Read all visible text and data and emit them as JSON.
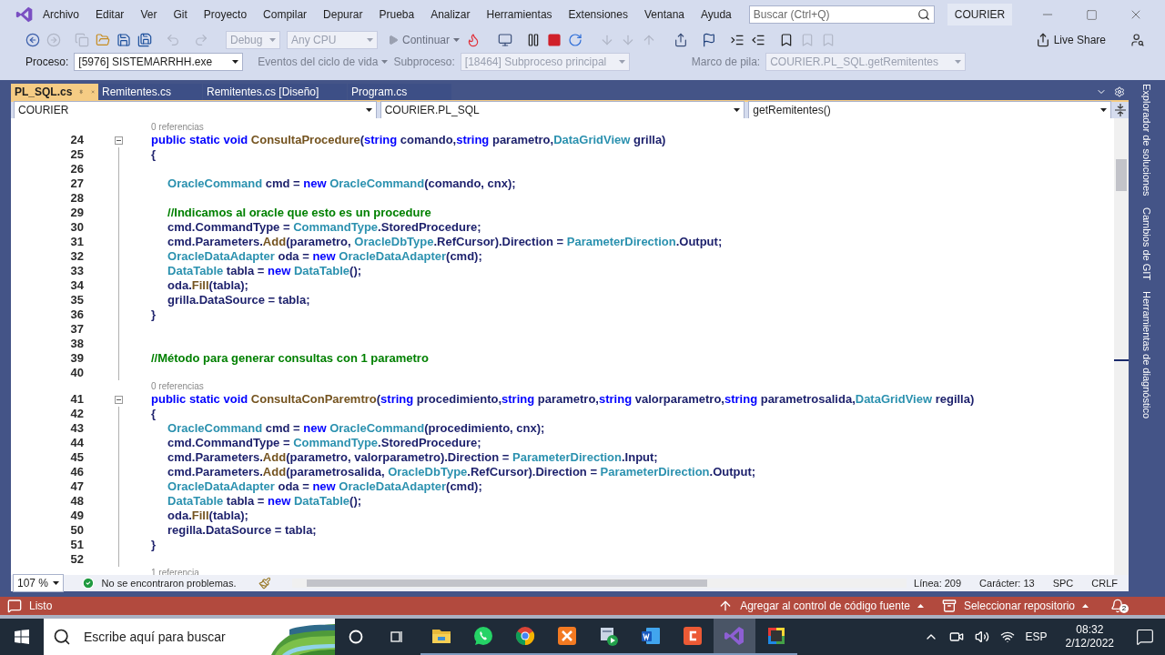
{
  "menu": {
    "items": [
      "Archivo",
      "Editar",
      "Ver",
      "Git",
      "Proyecto",
      "Compilar",
      "Depurar",
      "Prueba",
      "Analizar",
      "Herramientas",
      "Extensiones",
      "Ventana",
      "Ayuda"
    ],
    "search_placeholder": "Buscar (Ctrl+Q)",
    "solution": "COURIER"
  },
  "toolbar": {
    "configuration": "Debug",
    "platform": "Any CPU",
    "continue": "Continuar",
    "live_share": "Live Share"
  },
  "debug_bar": {
    "process_label": "Proceso:",
    "process": "[5976] SISTEMARRHH.exe",
    "lifecycle": "Eventos del ciclo de vida",
    "thread_label": "Subproceso:",
    "thread": "[18464] Subproceso principal",
    "stack_label": "Marco de pila:",
    "stack": "COURIER.PL_SQL.getRemitentes"
  },
  "tabs": [
    {
      "label": "PL_SQL.cs",
      "selected": true
    },
    {
      "label": "Remitentes.cs",
      "selected": false
    },
    {
      "label": "Remitentes.cs [Diseño]",
      "selected": false
    },
    {
      "label": "Program.cs",
      "selected": false
    }
  ],
  "nav": {
    "project": "COURIER",
    "class": "COURIER.PL_SQL",
    "member": "getRemitentes()"
  },
  "editor": {
    "lines": [
      {
        "kind": "codelens",
        "text": "0 referencias"
      },
      {
        "kind": "header",
        "number": "24",
        "tokens": [
          {
            "kind": "k",
            "text": "public static void "
          },
          {
            "kind": "m",
            "text": "ConsultaProcedure"
          },
          {
            "kind": "p",
            "text": "("
          },
          {
            "kind": "k",
            "text": "string "
          },
          {
            "kind": "p",
            "text": "comando,"
          },
          {
            "kind": "k",
            "text": "string "
          },
          {
            "kind": "p",
            "text": "parametro,"
          },
          {
            "kind": "t",
            "text": "DataGridView"
          },
          {
            "kind": "p",
            "text": " grilla)"
          }
        ]
      },
      {
        "kind": "code",
        "number": "25",
        "tokens": [
          {
            "kind": "p",
            "text": "{"
          }
        ]
      },
      {
        "kind": "code",
        "number": "26"
      },
      {
        "kind": "code",
        "number": "27",
        "tokens": [
          {
            "kind": "t",
            "text": "     OracleCommand"
          },
          {
            "kind": "p",
            "text": " cmd = "
          },
          {
            "kind": "k",
            "text": "new "
          },
          {
            "kind": "t",
            "text": "OracleCommand"
          },
          {
            "kind": "p",
            "text": "(comando, cnx);"
          }
        ]
      },
      {
        "kind": "code",
        "number": "28"
      },
      {
        "kind": "code",
        "number": "29",
        "tokens": [
          {
            "kind": "c",
            "text": "     //Indicamos al oracle que esto es un procedure"
          }
        ]
      },
      {
        "kind": "code",
        "number": "30",
        "tokens": [
          {
            "kind": "p",
            "text": "     cmd.CommandType = "
          },
          {
            "kind": "t",
            "text": "CommandType"
          },
          {
            "kind": "p",
            "text": ".StoredProcedure;"
          }
        ]
      },
      {
        "kind": "code",
        "number": "31",
        "tokens": [
          {
            "kind": "p",
            "text": "     cmd.Parameters."
          },
          {
            "kind": "m",
            "text": "Add"
          },
          {
            "kind": "p",
            "text": "(parametro, "
          },
          {
            "kind": "t",
            "text": "OracleDbType"
          },
          {
            "kind": "p",
            "text": ".RefCursor).Direction = "
          },
          {
            "kind": "t",
            "text": "ParameterDirection"
          },
          {
            "kind": "p",
            "text": ".Output;"
          }
        ]
      },
      {
        "kind": "code",
        "number": "32",
        "tokens": [
          {
            "kind": "t",
            "text": "     OracleDataAdapter"
          },
          {
            "kind": "p",
            "text": " oda = "
          },
          {
            "kind": "k",
            "text": "new "
          },
          {
            "kind": "t",
            "text": "OracleDataAdapter"
          },
          {
            "kind": "p",
            "text": "(cmd);"
          }
        ]
      },
      {
        "kind": "code",
        "number": "33",
        "tokens": [
          {
            "kind": "t",
            "text": "     DataTable"
          },
          {
            "kind": "p",
            "text": " tabla = "
          },
          {
            "kind": "k",
            "text": "new "
          },
          {
            "kind": "t",
            "text": "DataTable"
          },
          {
            "kind": "p",
            "text": "();"
          }
        ]
      },
      {
        "kind": "code",
        "number": "34",
        "tokens": [
          {
            "kind": "p",
            "text": "     oda."
          },
          {
            "kind": "m",
            "text": "Fill"
          },
          {
            "kind": "p",
            "text": "(tabla);"
          }
        ]
      },
      {
        "kind": "code",
        "number": "35",
        "tokens": [
          {
            "kind": "p",
            "text": "     grilla.DataSource = tabla;"
          }
        ]
      },
      {
        "kind": "code",
        "number": "36",
        "tokens": [
          {
            "kind": "p",
            "text": "}"
          }
        ]
      },
      {
        "kind": "code",
        "number": "37"
      },
      {
        "kind": "code",
        "number": "38"
      },
      {
        "kind": "code",
        "number": "39",
        "tokens": [
          {
            "kind": "c",
            "text": "//Método para generar consultas con 1 parametro"
          }
        ]
      },
      {
        "kind": "code",
        "number": "40"
      },
      {
        "kind": "codelens",
        "text": "0 referencias"
      },
      {
        "kind": "header",
        "number": "41",
        "tokens": [
          {
            "kind": "k",
            "text": "public static void "
          },
          {
            "kind": "m",
            "text": "ConsultaConParemtro"
          },
          {
            "kind": "p",
            "text": "("
          },
          {
            "kind": "k",
            "text": "string "
          },
          {
            "kind": "p",
            "text": "procedimiento,"
          },
          {
            "kind": "k",
            "text": "string "
          },
          {
            "kind": "p",
            "text": "parametro,"
          },
          {
            "kind": "k",
            "text": "string "
          },
          {
            "kind": "p",
            "text": "valorparametro,"
          },
          {
            "kind": "k",
            "text": "string "
          },
          {
            "kind": "p",
            "text": "parametrosalida,"
          },
          {
            "kind": "t",
            "text": "DataGridView"
          },
          {
            "kind": "p",
            "text": " regilla)"
          }
        ]
      },
      {
        "kind": "code",
        "number": "42",
        "tokens": [
          {
            "kind": "p",
            "text": "{"
          }
        ]
      },
      {
        "kind": "code",
        "number": "43",
        "tokens": [
          {
            "kind": "t",
            "text": "     OracleCommand"
          },
          {
            "kind": "p",
            "text": " cmd = "
          },
          {
            "kind": "k",
            "text": "new "
          },
          {
            "kind": "t",
            "text": "OracleCommand"
          },
          {
            "kind": "p",
            "text": "(procedimiento, cnx);"
          }
        ]
      },
      {
        "kind": "code",
        "number": "44",
        "tokens": [
          {
            "kind": "p",
            "text": "     cmd.CommandType = "
          },
          {
            "kind": "t",
            "text": "CommandType"
          },
          {
            "kind": "p",
            "text": ".StoredProcedure;"
          }
        ]
      },
      {
        "kind": "code",
        "number": "45",
        "tokens": [
          {
            "kind": "p",
            "text": "     cmd.Parameters."
          },
          {
            "kind": "m",
            "text": "Add"
          },
          {
            "kind": "p",
            "text": "(parametro, valorparametro).Direction = "
          },
          {
            "kind": "t",
            "text": "ParameterDirection"
          },
          {
            "kind": "p",
            "text": ".Input;"
          }
        ]
      },
      {
        "kind": "code",
        "number": "46",
        "tokens": [
          {
            "kind": "p",
            "text": "     cmd.Parameters."
          },
          {
            "kind": "m",
            "text": "Add"
          },
          {
            "kind": "p",
            "text": "(parametrosalida, "
          },
          {
            "kind": "t",
            "text": "OracleDbType"
          },
          {
            "kind": "p",
            "text": ".RefCursor).Direction = "
          },
          {
            "kind": "t",
            "text": "ParameterDirection"
          },
          {
            "kind": "p",
            "text": ".Output;"
          }
        ]
      },
      {
        "kind": "code",
        "number": "47",
        "tokens": [
          {
            "kind": "t",
            "text": "     OracleDataAdapter"
          },
          {
            "kind": "p",
            "text": " oda = "
          },
          {
            "kind": "k",
            "text": "new "
          },
          {
            "kind": "t",
            "text": "OracleDataAdapter"
          },
          {
            "kind": "p",
            "text": "(cmd);"
          }
        ]
      },
      {
        "kind": "code",
        "number": "48",
        "tokens": [
          {
            "kind": "t",
            "text": "     DataTable"
          },
          {
            "kind": "p",
            "text": " tabla = "
          },
          {
            "kind": "k",
            "text": "new "
          },
          {
            "kind": "t",
            "text": "DataTable"
          },
          {
            "kind": "p",
            "text": "();"
          }
        ]
      },
      {
        "kind": "code",
        "number": "49",
        "tokens": [
          {
            "kind": "p",
            "text": "     oda."
          },
          {
            "kind": "m",
            "text": "Fill"
          },
          {
            "kind": "p",
            "text": "(tabla);"
          }
        ]
      },
      {
        "kind": "code",
        "number": "50",
        "tokens": [
          {
            "kind": "p",
            "text": "     regilla.DataSource = tabla;"
          }
        ]
      },
      {
        "kind": "code",
        "number": "51",
        "tokens": [
          {
            "kind": "p",
            "text": "}"
          }
        ]
      },
      {
        "kind": "code",
        "number": "52"
      },
      {
        "kind": "codelens",
        "text": "1 referencia"
      }
    ]
  },
  "editor_status": {
    "zoom": "107 %",
    "issues": "No se encontraron problemas.",
    "line": "Línea: 209",
    "character": "Carácter: 13",
    "whitespace": "SPC",
    "line_ending": "CRLF"
  },
  "side_tabs": [
    "Explorador de soluciones",
    "Cambios de GIT",
    "Herramientas de diagnóstico"
  ],
  "status_bar": {
    "text": "Listo",
    "source_control": "Agregar al control de código fuente",
    "repository": "Seleccionar repositorio",
    "notifications": "2"
  },
  "taskbar": {
    "search_placeholder": "Escribe aquí para buscar",
    "language": "ESP",
    "time": "08:32",
    "date": "2/12/2022",
    "apps": [
      {
        "kind": "files",
        "selected": false
      },
      {
        "kind": "whatsapp",
        "selected": false
      },
      {
        "kind": "chrome",
        "selected": false
      },
      {
        "kind": "xampp",
        "selected": false
      },
      {
        "kind": "player",
        "selected": false
      },
      {
        "kind": "word",
        "selected": false
      },
      {
        "kind": "camtasia",
        "selected": false
      },
      {
        "kind": "vs",
        "selected": true
      },
      {
        "kind": "palette",
        "selected": false
      }
    ]
  }
}
